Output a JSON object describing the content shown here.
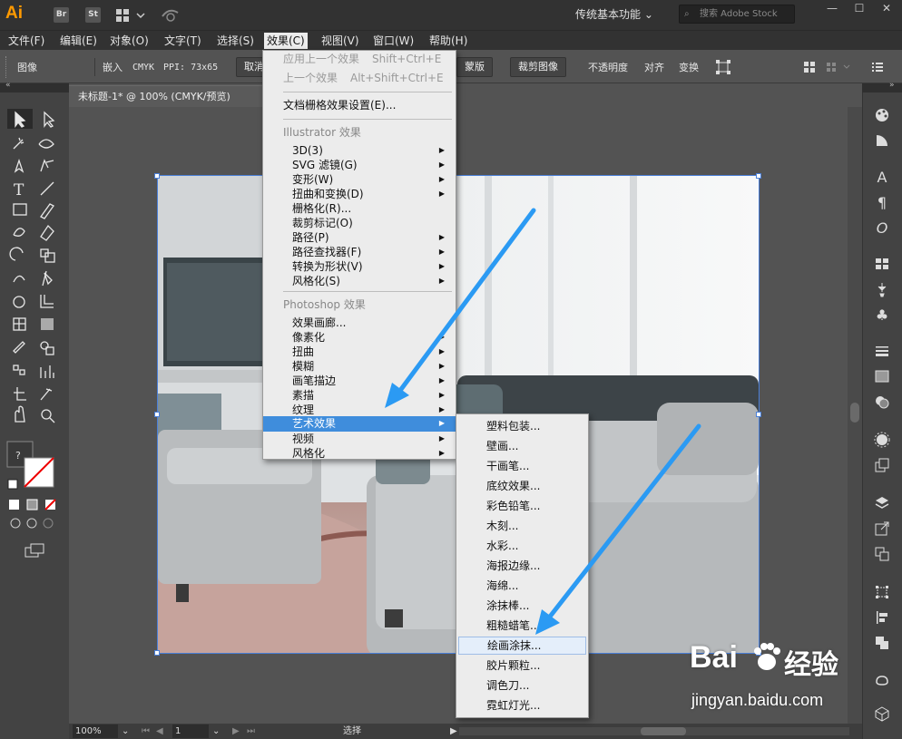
{
  "app": {
    "logo": "Ai",
    "bridge": "Br",
    "stock": "St",
    "workspace": "传统基本功能",
    "search_placeholder": "搜索 Adobe Stock"
  },
  "menubar": [
    "文件(F)",
    "编辑(E)",
    "对象(O)",
    "文字(T)",
    "选择(S)",
    "效果(C)",
    "视图(V)",
    "窗口(W)",
    "帮助(H)"
  ],
  "control": {
    "type": "图像",
    "embed": "嵌入",
    "mode": "CMYK",
    "ppi": "PPI: 73x65",
    "cancel": "取消",
    "trace": "蒙版",
    "crop": "裁剪图像",
    "opacity": "不透明度",
    "align": "对齐",
    "transform": "变换"
  },
  "document": {
    "tab": "未标题-1* @ 100% (CMYK/预览)",
    "zoom": "100%",
    "page": "1",
    "status": "选择"
  },
  "effect_menu": {
    "apply_last": "应用上一个效果",
    "apply_last_sc": "Shift+Ctrl+E",
    "last": "上一个效果",
    "last_sc": "Alt+Shift+Ctrl+E",
    "raster_settings": "文档栅格效果设置(E)...",
    "illustrator_header": "Illustrator 效果",
    "illustrator_items": [
      "3D(3)",
      "SVG 滤镜(G)",
      "变形(W)",
      "扭曲和变换(D)",
      "栅格化(R)...",
      "裁剪标记(O)",
      "路径(P)",
      "路径查找器(F)",
      "转换为形状(V)",
      "风格化(S)"
    ],
    "photoshop_header": "Photoshop 效果",
    "photoshop_items": [
      "效果画廊...",
      "像素化",
      "扭曲",
      "模糊",
      "画笔描边",
      "素描",
      "纹理",
      "艺术效果",
      "视频",
      "风格化"
    ]
  },
  "artistic_submenu": [
    "塑料包装...",
    "壁画...",
    "干画笔...",
    "底纹效果...",
    "彩色铅笔...",
    "木刻...",
    "水彩...",
    "海报边缘...",
    "海绵...",
    "涂抹棒...",
    "粗糙蜡笔...",
    "绘画涂抹...",
    "胶片颗粒...",
    "调色刀...",
    "霓虹灯光..."
  ],
  "selected_submenu_item": "绘画涂抹...",
  "highlighted_menu_item": "艺术效果",
  "watermark": {
    "brand": "Bai",
    "brand2": "经验",
    "url": "jingyan.baidu.com"
  },
  "colors": {
    "highlight": "#3f8ddc",
    "arrow": "#2b9af3",
    "accent": "#ff9a00"
  }
}
